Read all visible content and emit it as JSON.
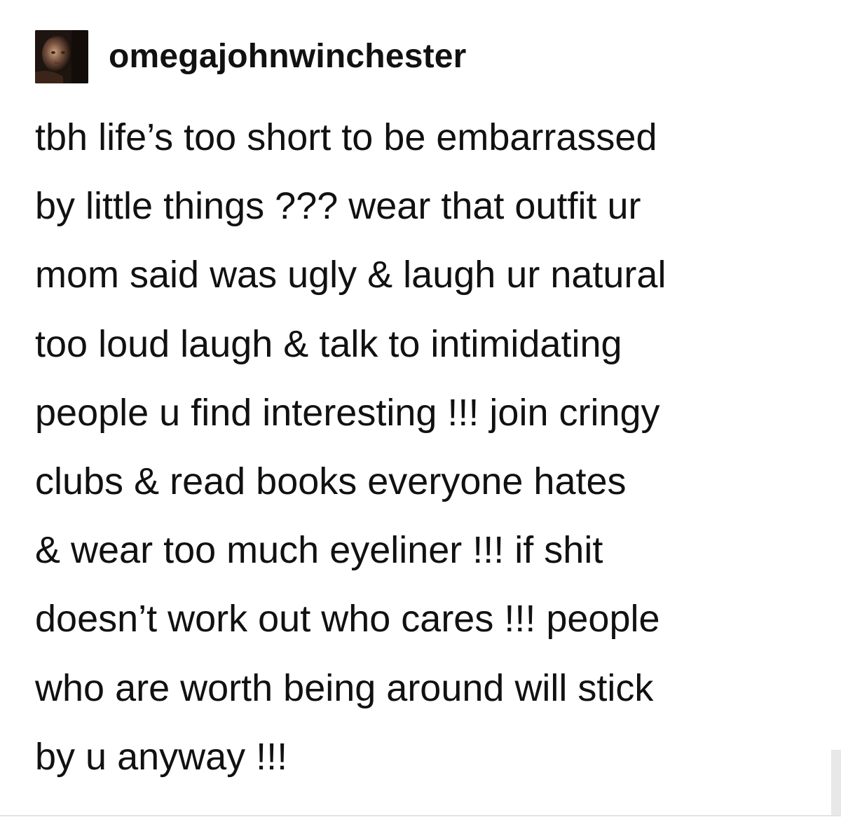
{
  "post": {
    "username": "omegajohnwinchester",
    "avatar_icon": "user-avatar-photo",
    "body_lines": [
      "tbh life’s too short to be embarrassed",
      "by little things ??? wear that outfit ur",
      "mom said was ugly & laugh ur natural",
      "too loud laugh & talk to intimidating",
      "people u find interesting !!! join cringy",
      "clubs & read books everyone hates",
      "& wear too much eyeliner !!! if shit",
      "doesn’t work out who cares !!! people",
      "who are worth being around will stick",
      "by u anyway !!!"
    ]
  },
  "colors": {
    "text": "#111111",
    "background": "#ffffff",
    "rule": "#e3e3e3"
  }
}
